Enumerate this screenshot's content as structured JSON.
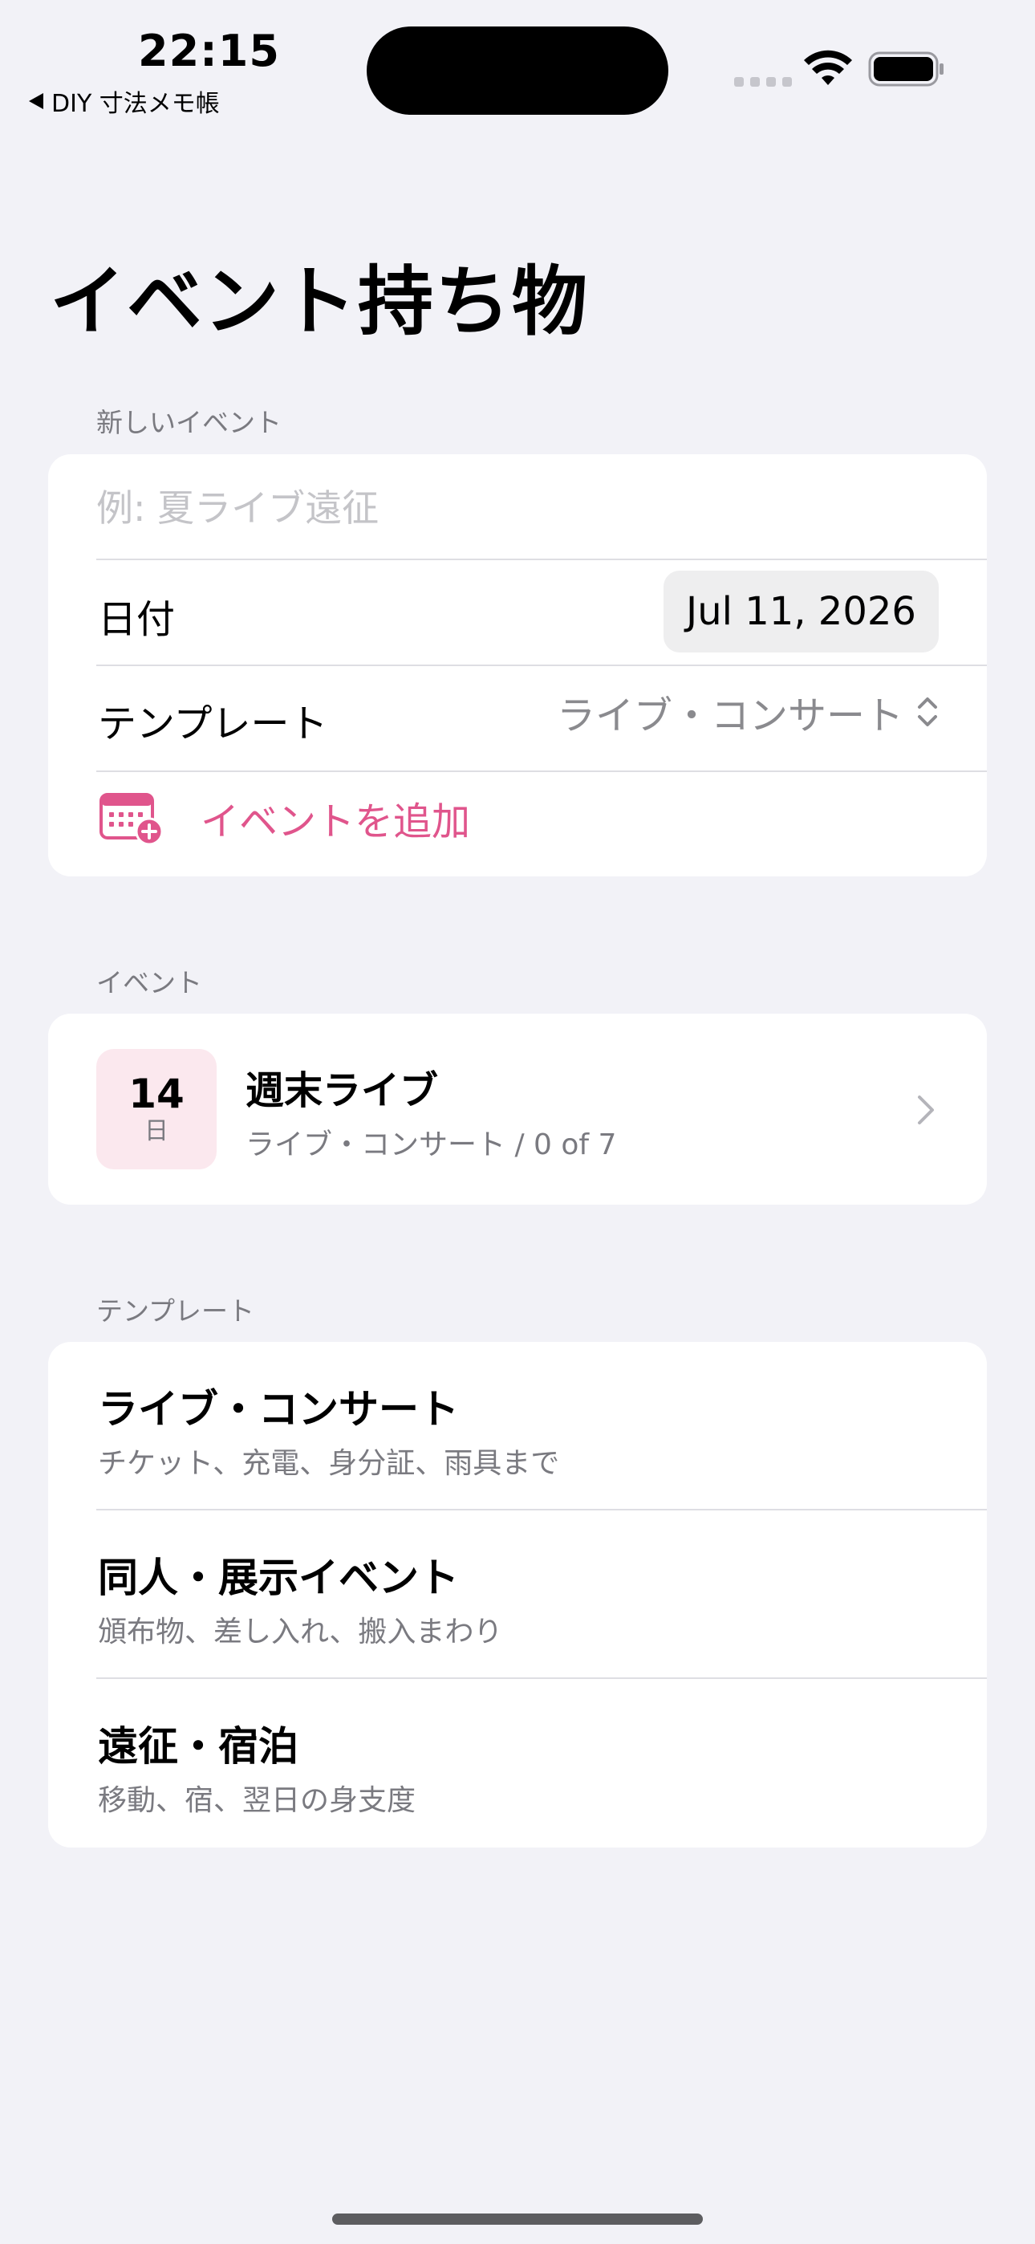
{
  "status_bar": {
    "time": "22:15",
    "back_label": "DIY 寸法メモ帳"
  },
  "page": {
    "title": "イベント持ち物"
  },
  "new_event": {
    "header": "新しいイベント",
    "name_placeholder": "例: 夏ライブ遠征",
    "date_label": "日付",
    "date_value": "Jul 11, 2026",
    "template_label": "テンプレート",
    "template_value": "ライブ・コンサート",
    "add_label": "イベントを追加"
  },
  "events": {
    "header": "イベント",
    "items": [
      {
        "day": "14",
        "day_unit": "日",
        "title": "週末ライブ",
        "subtitle": "ライブ・コンサート / 0 of 7"
      }
    ]
  },
  "templates": {
    "header": "テンプレート",
    "items": [
      {
        "title": "ライブ・コンサート",
        "description": "チケット、充電、身分証、雨具まで"
      },
      {
        "title": "同人・展示イベント",
        "description": "頒布物、差し入れ、搬入まわり"
      },
      {
        "title": "遠征・宿泊",
        "description": "移動、宿、翌日の身支度"
      }
    ]
  },
  "colors": {
    "accent": "#e0558c",
    "background": "#f2f2f7",
    "event_date_bg": "#fbe8ee"
  },
  "icons": {
    "back": "back-triangle-icon",
    "wifi": "wifi-icon",
    "battery": "battery-icon",
    "add_event": "calendar-add-icon",
    "template_picker": "chevron-up-down-icon",
    "event_row": "chevron-right-icon"
  }
}
